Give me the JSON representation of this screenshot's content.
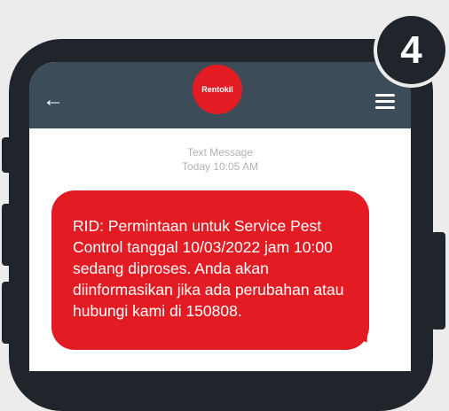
{
  "step_badge": "4",
  "header": {
    "back_icon": "arrow-left-icon",
    "logo_text": "Rentokil",
    "menu_icon": "hamburger-menu-icon"
  },
  "message": {
    "meta_line1": "Text Message",
    "meta_line2": "Today 10:05 AM",
    "body": "RID: Permintaan untuk Service Pest Control tanggal 10/03/2022 jam 10:00 sedang diproses. Anda akan diinformasikan jika ada perubahan atau hubungi kami di 150808."
  },
  "colors": {
    "bubble": "#e31c23",
    "header": "#3c4c58",
    "phone_frame": "#1f252b"
  }
}
